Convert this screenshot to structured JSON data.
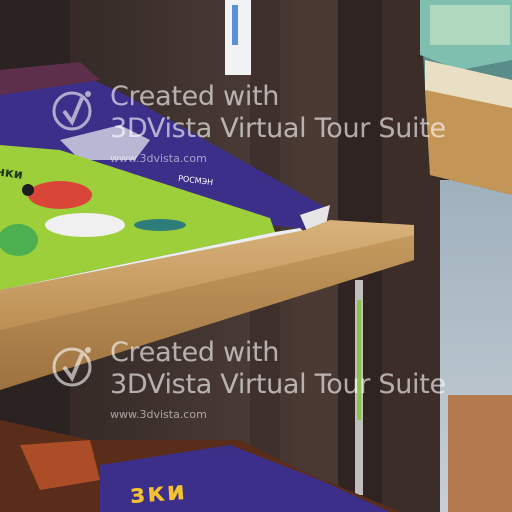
{
  "watermark": {
    "line1": "Created with",
    "line2": "3DVista Virtual Tour Suite",
    "url": "www.3dvista.com"
  },
  "books": {
    "top_cover_text_left": "нки",
    "top_cover_text_right": "РОСМЭН",
    "bottom_cover_text": "зки"
  },
  "colors": {
    "shelf_wood": "#c49a5c",
    "back_panel": "#3b2a26",
    "green_book": "#9ccf3a",
    "purple_book": "#3c2f8a"
  }
}
